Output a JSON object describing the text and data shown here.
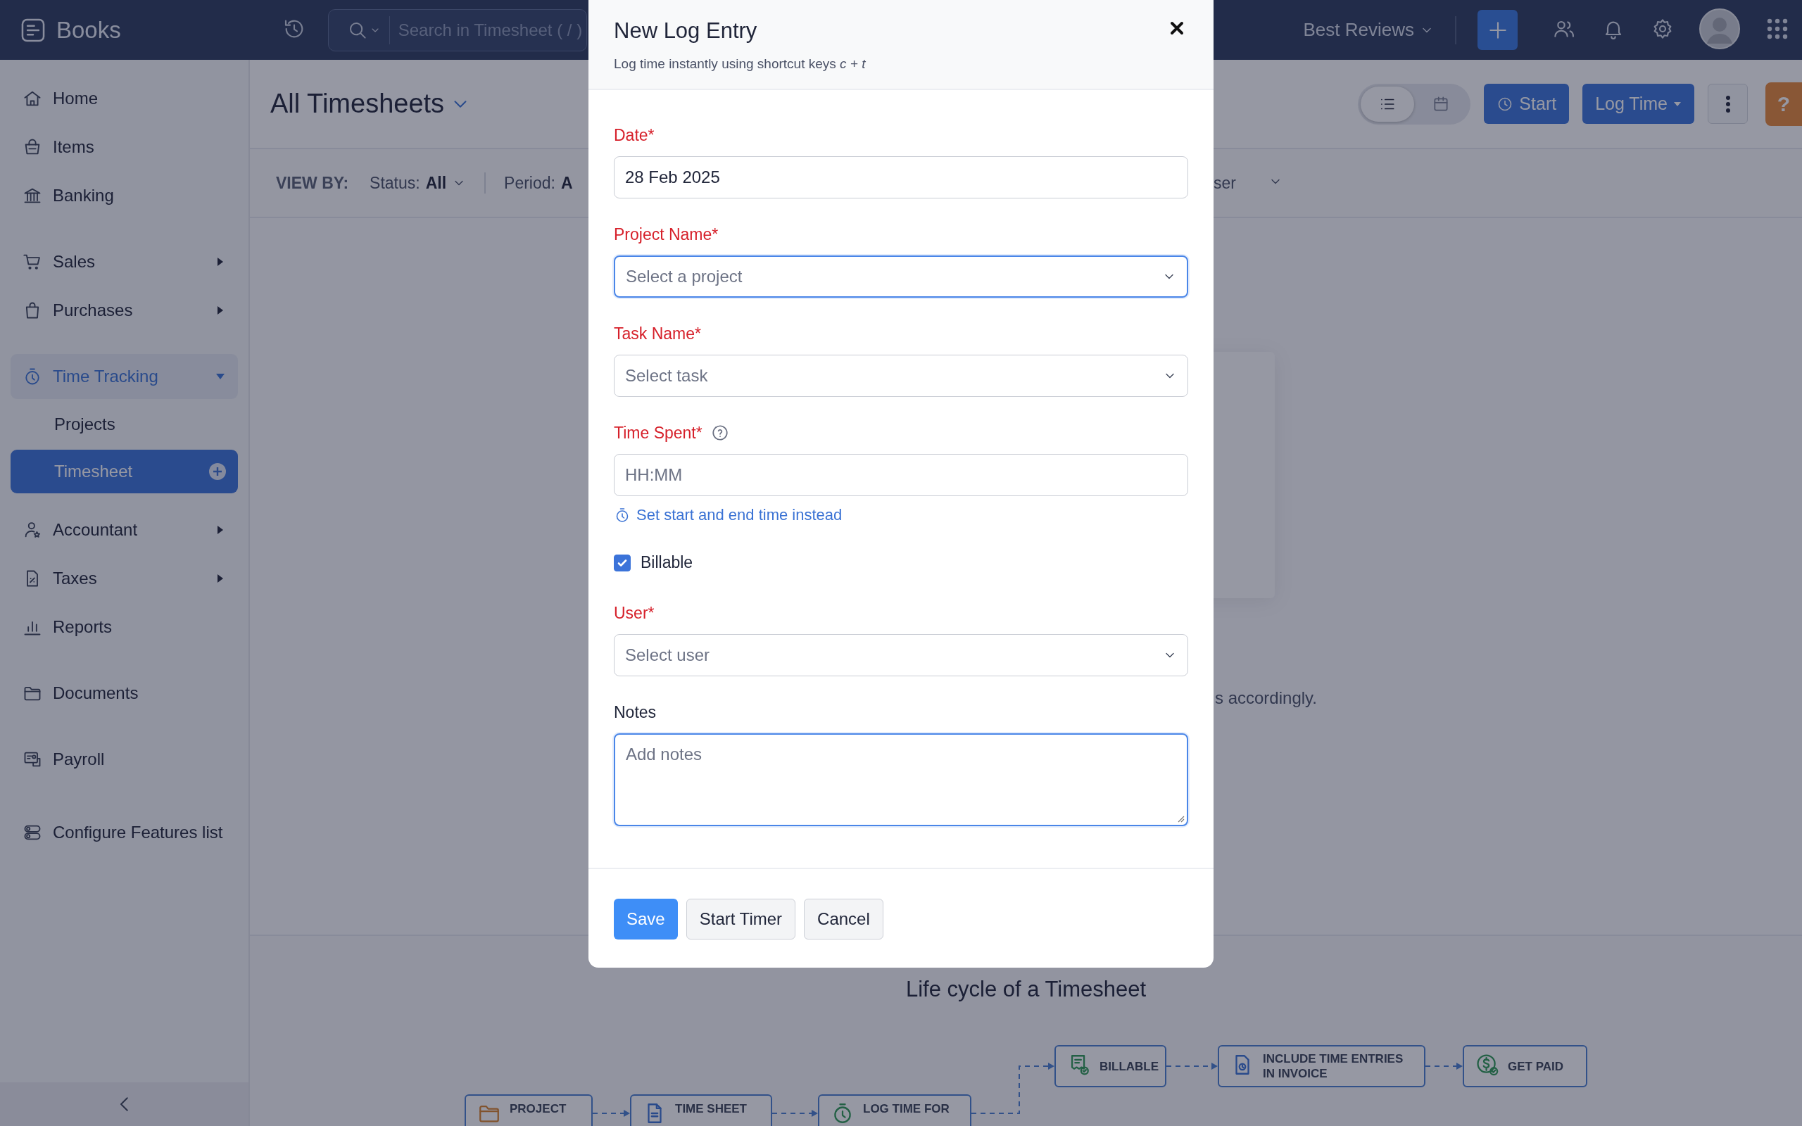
{
  "app": {
    "name": "Books"
  },
  "search": {
    "placeholder": "Search in Timesheet ( / )"
  },
  "organization": {
    "name": "Best Reviews"
  },
  "sidebar": {
    "sections": [
      {
        "items": [
          {
            "label": "Home",
            "kind": "link",
            "selected": false
          },
          {
            "label": "Items",
            "kind": "link",
            "selected": false
          },
          {
            "label": "Banking",
            "kind": "link",
            "selected": false
          }
        ]
      },
      {
        "items": [
          {
            "label": "Sales",
            "kind": "group",
            "expanded": false,
            "selected": false
          },
          {
            "label": "Purchases",
            "kind": "group",
            "expanded": false,
            "selected": false
          }
        ]
      },
      {
        "items": [
          {
            "label": "Time Tracking",
            "kind": "group",
            "expanded": true,
            "selected": true,
            "children": [
              {
                "label": "Projects",
                "selected": false
              },
              {
                "label": "Timesheet",
                "selected": true
              }
            ]
          },
          {
            "label": "Accountant",
            "kind": "group",
            "expanded": false,
            "selected": false
          },
          {
            "label": "Taxes",
            "kind": "group",
            "expanded": false,
            "selected": false
          },
          {
            "label": "Reports",
            "kind": "link",
            "selected": false
          }
        ]
      },
      {
        "items": [
          {
            "label": "Documents",
            "kind": "link",
            "selected": false
          }
        ]
      },
      {
        "items": [
          {
            "label": "Payroll",
            "kind": "link",
            "selected": false
          }
        ]
      },
      {
        "items": [
          {
            "label": "Configure Features list",
            "kind": "link",
            "selected": false
          }
        ]
      }
    ]
  },
  "main": {
    "title": "All Timesheets",
    "views": [
      {
        "kind": "list",
        "selected": true
      },
      {
        "kind": "calendar",
        "selected": false
      }
    ],
    "actions": [
      {
        "kind": "timer",
        "label": "Start"
      },
      {
        "kind": "dropdown",
        "label": "Log Time"
      },
      {
        "kind": "more"
      }
    ],
    "help_tab": "?",
    "filters": {
      "label": "VIEW BY:",
      "status_label": "Status:",
      "status_value": "All",
      "period_label": "Period:",
      "period_value": "A",
      "column_3": "ser"
    },
    "empty_text": "s accordingly.",
    "lifecycle": {
      "title": "Life cycle of a Timesheet",
      "steps": [
        {
          "label": "PROJECT"
        },
        {
          "label": "TIME SHEET"
        },
        {
          "label": "LOG TIME FOR"
        },
        {
          "label": "BILLABLE"
        },
        {
          "label": "INCLUDE TIME ENTRIES IN INVOICE"
        },
        {
          "label": "GET PAID"
        }
      ]
    }
  },
  "modal": {
    "title": "New Log Entry",
    "subtitle": "Log time instantly using shortcut keys *c + t*",
    "fields": [
      {
        "kind": "text",
        "label": "Date*",
        "required": true,
        "value": "28 Feb 2025",
        "focused": false
      },
      {
        "kind": "select",
        "label": "Project Name*",
        "required": true,
        "placeholder": "Select a project",
        "focused": true
      },
      {
        "kind": "select",
        "label": "Task Name*",
        "required": true,
        "placeholder": "Select task",
        "focused": false
      },
      {
        "kind": "time",
        "label": "Time Spent*",
        "required": true,
        "placeholder": "HH:MM",
        "focused": false,
        "link": "Set start and end time instead"
      },
      {
        "kind": "checkbox",
        "label": "Billable",
        "checked": true
      },
      {
        "kind": "select",
        "label": "User*",
        "required": true,
        "placeholder": "Select user",
        "focused": false
      },
      {
        "kind": "textarea",
        "label": "Notes",
        "required": false,
        "placeholder": "Add notes",
        "focused": true
      }
    ],
    "buttons": [
      {
        "kind": "primary",
        "label": "Save"
      },
      {
        "kind": "secondary",
        "label": "Start Timer"
      },
      {
        "kind": "secondary",
        "label": "Cancel"
      }
    ]
  }
}
